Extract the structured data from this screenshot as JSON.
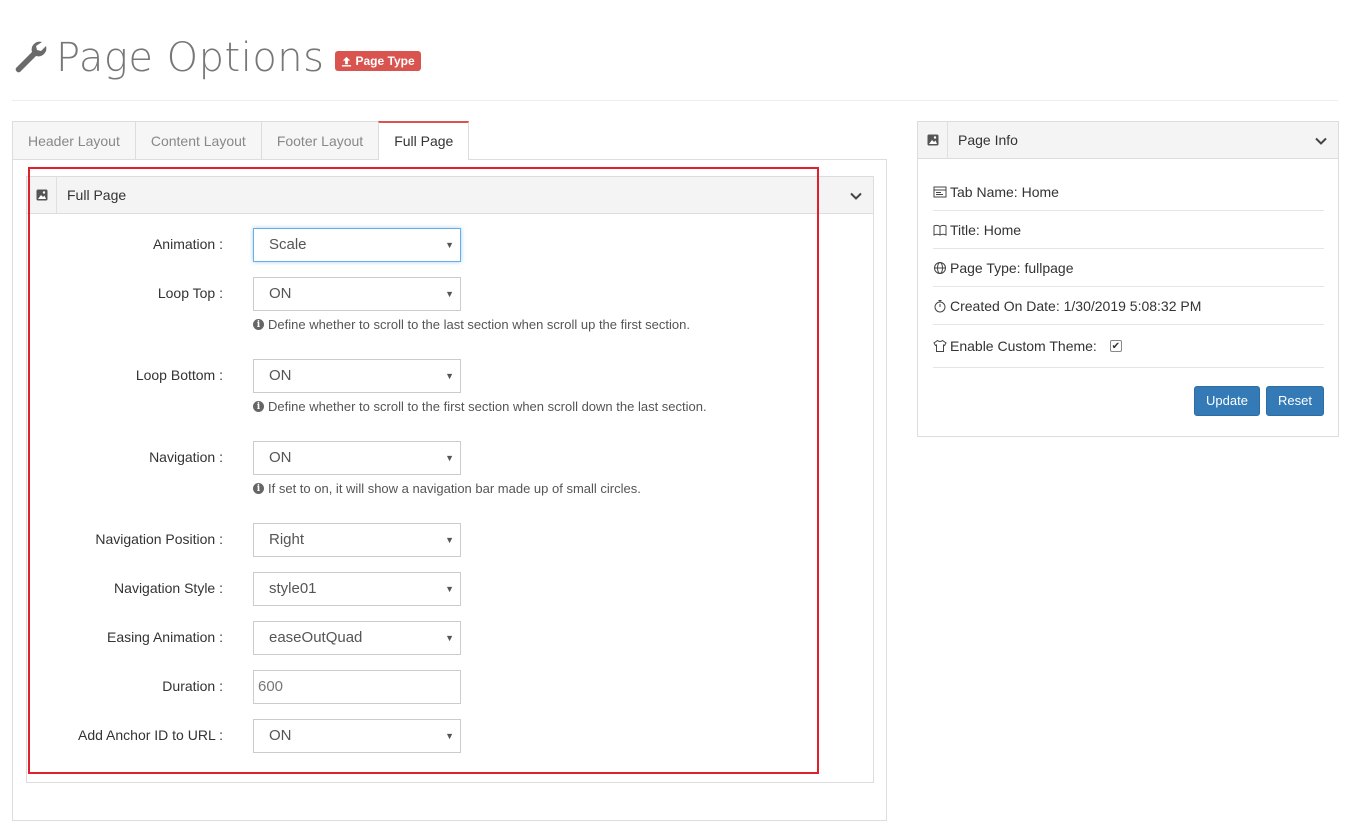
{
  "header": {
    "title": "Page Options",
    "badge_label": "Page Type"
  },
  "tabs": [
    {
      "label": "Header Layout"
    },
    {
      "label": "Content Layout"
    },
    {
      "label": "Footer Layout"
    },
    {
      "label": "Full Page",
      "active": true
    }
  ],
  "full_page_panel": {
    "title": "Full Page",
    "fields": {
      "animation": {
        "label": "Animation :",
        "value": "Scale"
      },
      "loop_top": {
        "label": "Loop Top :",
        "value": "ON",
        "help": "Define whether to scroll to the last section when scroll up the first section."
      },
      "loop_bottom": {
        "label": "Loop Bottom :",
        "value": "ON",
        "help": "Define whether to scroll to the first section when scroll down the last section."
      },
      "navigation": {
        "label": "Navigation :",
        "value": "ON",
        "help": "If set to on, it will show a navigation bar made up of small circles."
      },
      "navigation_position": {
        "label": "Navigation Position :",
        "value": "Right"
      },
      "navigation_style": {
        "label": "Navigation Style :",
        "value": "style01"
      },
      "easing_animation": {
        "label": "Easing Animation :",
        "value": "easeOutQuad"
      },
      "duration": {
        "label": "Duration :",
        "value": "600"
      },
      "anchor_id": {
        "label": "Add Anchor ID to URL :",
        "value": "ON"
      }
    }
  },
  "page_info": {
    "title": "Page Info",
    "tab_name": "Tab Name: Home",
    "title_line": "Title: Home",
    "page_type": "Page Type: fullpage",
    "created_on": "Created On Date: 1/30/2019 5:08:32 PM",
    "custom_theme_label": "Enable Custom Theme:",
    "custom_theme_checked": true,
    "update_label": "Update",
    "reset_label": "Reset"
  },
  "colors": {
    "accent_red": "#d9534f",
    "primary_blue": "#337ab7",
    "highlight_box": "#e0202a"
  }
}
